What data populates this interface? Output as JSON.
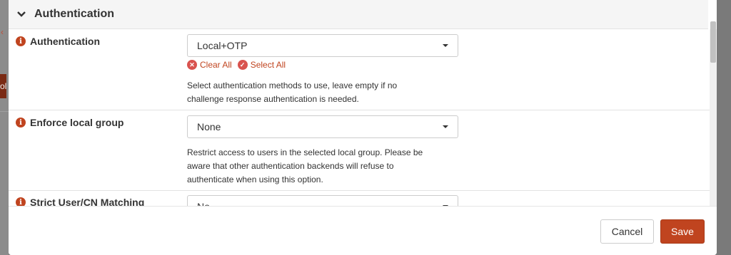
{
  "background": {
    "button_text": "ol"
  },
  "section": {
    "title": "Authentication"
  },
  "rows": [
    {
      "label": "Authentication",
      "select_value": "Local+OTP",
      "clear_all": "Clear All",
      "select_all": "Select All",
      "help_lines": [
        "Select authentication methods to use, leave empty if no",
        "challenge response authentication is needed."
      ]
    },
    {
      "label": "Enforce local group",
      "select_value": "None",
      "help_lines": [
        "Restrict access to users in the selected local group. Please be",
        "aware that other authentication backends will refuse to",
        "authenticate when using this option."
      ]
    },
    {
      "label": "Strict User/CN Matching",
      "select_value": "No"
    }
  ],
  "footer": {
    "cancel_label": "Cancel",
    "save_label": "Save"
  },
  "colors": {
    "accent": "#c0441f",
    "danger": "#d9534f"
  }
}
